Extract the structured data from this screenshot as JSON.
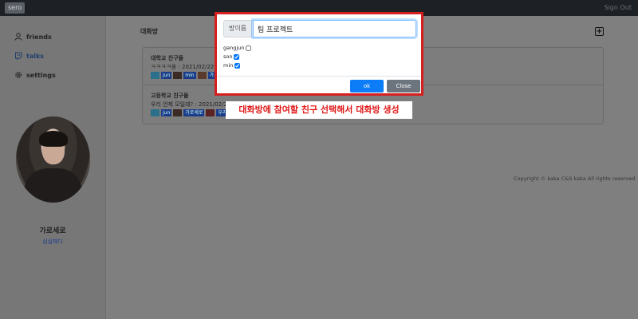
{
  "header": {
    "brand": "sero",
    "sign_out": "Sign Out"
  },
  "sidebar": {
    "items": [
      {
        "label": "friends",
        "icon": "person-icon"
      },
      {
        "label": "talks",
        "icon": "twitch-icon"
      },
      {
        "label": "settings",
        "icon": "gear-icon"
      }
    ],
    "user_name": "가로세로",
    "user_status": "심심해다"
  },
  "main": {
    "title": "대화방",
    "rooms": [
      {
        "name": "대학교 친구들",
        "message": "ㅋㅋㅋㅋ웅 : 2021/02/22 2",
        "members": [
          "jun",
          "min",
          "가로"
        ]
      },
      {
        "name": "고등학교 친구들",
        "message": "우리 언제 모일래? : 2021/02/2",
        "members": [
          "jun",
          "가로세로",
          "우리"
        ]
      }
    ],
    "copyright": "Copyright © kaka C&S kaka All rights reserved"
  },
  "modal": {
    "name_label": "방이름",
    "room_name_value": "팀 프로젝트",
    "friends": [
      {
        "name": "gangjun",
        "checked": false
      },
      {
        "name": "son",
        "checked": true
      },
      {
        "name": "min",
        "checked": true
      }
    ],
    "ok_label": "ok",
    "close_label": "Close"
  },
  "annotation": "대화방에 참여할 친구 선택해서 대화방 생성",
  "colors": {
    "modal_border": "#d62020",
    "ok_button": "#0d7cf7",
    "close_button": "#6c757d",
    "annotation_text": "#e01818"
  }
}
